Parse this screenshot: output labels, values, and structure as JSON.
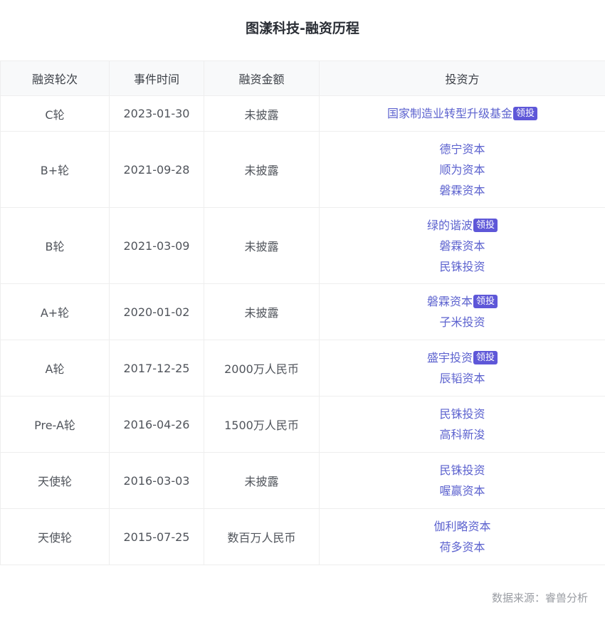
{
  "page": {
    "title": "图漾科技-融资历程",
    "lead_badge": "领投",
    "source": "数据来源：睿兽分析"
  },
  "table": {
    "columns": [
      "融资轮次",
      "事件时间",
      "融资金额",
      "投资方"
    ],
    "rows": [
      {
        "round": "C轮",
        "date": "2023-01-30",
        "amount": "未披露",
        "investors": [
          {
            "name": "国家制造业转型升级基金",
            "lead": true
          }
        ]
      },
      {
        "round": "B+轮",
        "date": "2021-09-28",
        "amount": "未披露",
        "investors": [
          {
            "name": "德宁资本",
            "lead": false
          },
          {
            "name": "顺为资本",
            "lead": false
          },
          {
            "name": "磐霖资本",
            "lead": false
          }
        ]
      },
      {
        "round": "B轮",
        "date": "2021-03-09",
        "amount": "未披露",
        "investors": [
          {
            "name": "绿的谐波",
            "lead": true
          },
          {
            "name": "磐霖资本",
            "lead": false
          },
          {
            "name": "民铢投资",
            "lead": false
          }
        ]
      },
      {
        "round": "A+轮",
        "date": "2020-01-02",
        "amount": "未披露",
        "investors": [
          {
            "name": "磐霖资本",
            "lead": true
          },
          {
            "name": "子米投资",
            "lead": false
          }
        ]
      },
      {
        "round": "A轮",
        "date": "2017-12-25",
        "amount": "2000万人民币",
        "investors": [
          {
            "name": "盛宇投资",
            "lead": true
          },
          {
            "name": "辰韬资本",
            "lead": false
          }
        ]
      },
      {
        "round": "Pre-A轮",
        "date": "2016-04-26",
        "amount": "1500万人民币",
        "investors": [
          {
            "name": "民铢投资",
            "lead": false
          },
          {
            "name": "高科新浚",
            "lead": false
          }
        ]
      },
      {
        "round": "天使轮",
        "date": "2016-03-03",
        "amount": "未披露",
        "investors": [
          {
            "name": "民铢投资",
            "lead": false
          },
          {
            "name": "喔赢资本",
            "lead": false
          }
        ]
      },
      {
        "round": "天使轮",
        "date": "2015-07-25",
        "amount": "数百万人民币",
        "investors": [
          {
            "name": "伽利略资本",
            "lead": false
          },
          {
            "name": "荷多资本",
            "lead": false
          }
        ]
      }
    ]
  }
}
